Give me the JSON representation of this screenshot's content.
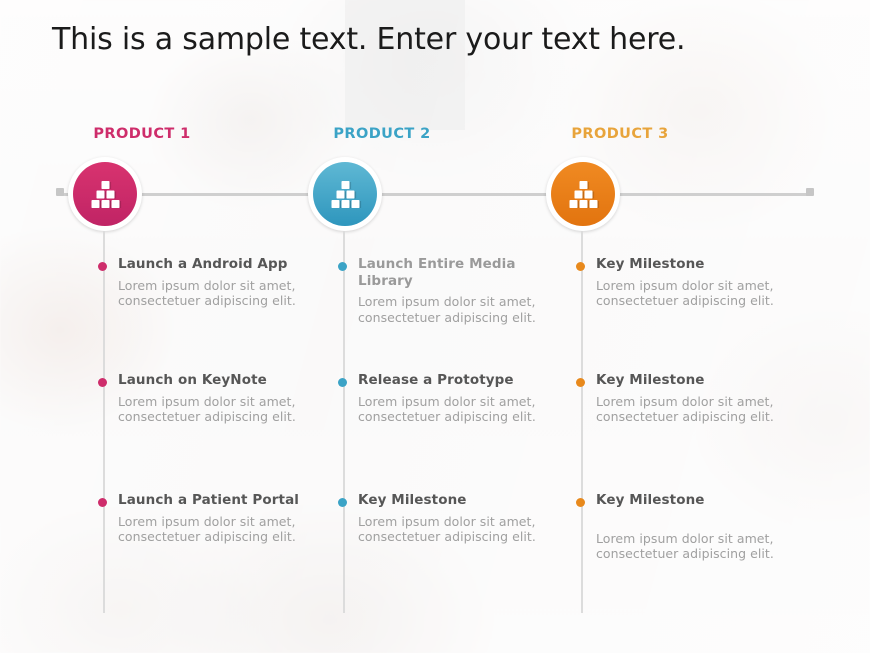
{
  "slide": {
    "title": "This is a sample text. Enter your text here."
  },
  "colors": {
    "product1": "#ce2d6b",
    "product2": "#3ba3c6",
    "product3": "#e8891c",
    "product3_label": "#e8a43b",
    "spine": "#cfcfcf",
    "title_text": "#1b1b1b",
    "item_title": "#565656",
    "item_body": "#a0a0a0"
  },
  "columns": [
    {
      "label": "PRODUCT 1",
      "label_color": "#ce2d6b",
      "badge_color_top": "#d8336f",
      "badge_color_bottom": "#c02465",
      "icon": "blocks-pyramid-icon",
      "dot_color": "#ce2d6b",
      "items": [
        {
          "title": "Launch a Android App",
          "body": "Lorem ipsum dolor sit amet, consectetuer adipiscing elit.",
          "muted": false,
          "gap": false
        },
        {
          "title": "Launch on KeyNote",
          "body": "Lorem ipsum dolor sit amet, consectetuer adipiscing elit.",
          "muted": false,
          "gap": false
        },
        {
          "title": "Launch a Patient Portal",
          "body": "Lorem ipsum dolor sit amet, consectetuer adipiscing elit.",
          "muted": false,
          "gap": false
        }
      ]
    },
    {
      "label": "PRODUCT 2",
      "label_color": "#3ba3c6",
      "badge_color_top": "#5fb8d4",
      "badge_color_bottom": "#2e96bd",
      "icon": "blocks-pyramid-icon",
      "dot_color": "#3ba3c6",
      "items": [
        {
          "title": "Launch Entire Media Library",
          "body": "Lorem ipsum dolor sit amet, consectetuer adipiscing elit.",
          "muted": true,
          "gap": false
        },
        {
          "title": "Release a Prototype",
          "body": "Lorem ipsum dolor sit amet, consectetuer adipiscing elit.",
          "muted": false,
          "gap": false
        },
        {
          "title": "Key Milestone",
          "body": "Lorem ipsum dolor sit amet, consectetuer adipiscing elit.",
          "muted": false,
          "gap": false
        }
      ]
    },
    {
      "label": "PRODUCT 3",
      "label_color": "#e8a43b",
      "badge_color_top": "#f08a22",
      "badge_color_bottom": "#e2740f",
      "icon": "blocks-pyramid-icon",
      "dot_color": "#e8891c",
      "items": [
        {
          "title": "Key Milestone",
          "body": "Lorem ipsum dolor sit amet, consectetuer adipiscing elit.",
          "muted": false,
          "gap": false
        },
        {
          "title": "Key Milestone",
          "body": "Lorem ipsum dolor sit amet, consectetuer adipiscing elit.",
          "muted": false,
          "gap": false
        },
        {
          "title": "Key Milestone",
          "body": "Lorem ipsum dolor sit amet, consectetuer adipiscing elit.",
          "muted": false,
          "gap": true
        }
      ]
    }
  ]
}
